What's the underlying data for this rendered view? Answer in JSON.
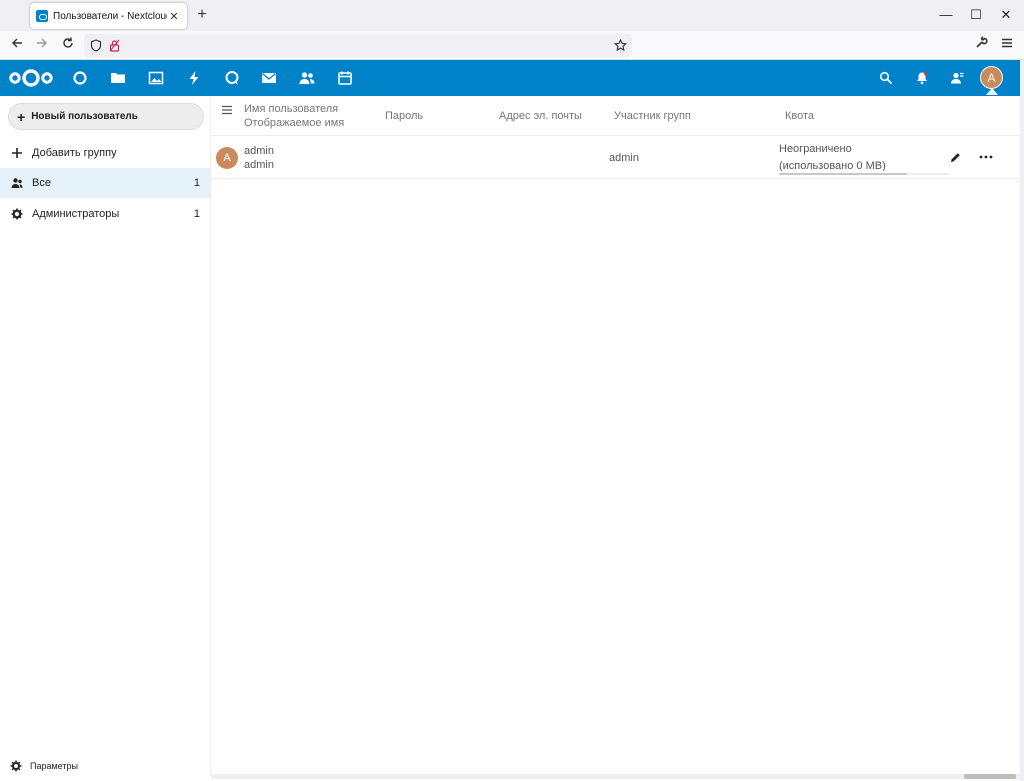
{
  "browser": {
    "tab_title": "Пользователи - Nextcloud",
    "tab_close": "✕",
    "new_tab": "+",
    "controls": {
      "minimize": "—",
      "maximize": "☐",
      "close": "✕"
    },
    "url": ""
  },
  "header": {
    "apps": [
      "dashboard-icon",
      "files-icon",
      "photos-icon",
      "activity-icon",
      "talk-icon",
      "mail-icon",
      "contacts-icon",
      "calendar-icon"
    ],
    "avatar_letter": "A",
    "accent": "#0082c9"
  },
  "sidebar": {
    "new_user": "Новый пользователь",
    "items": [
      {
        "label": "Добавить группу",
        "count": ""
      },
      {
        "label": "Все",
        "count": "1"
      },
      {
        "label": "Администраторы",
        "count": "1"
      }
    ],
    "settings": "Параметры"
  },
  "table": {
    "headers": {
      "username": "Имя пользователя",
      "displayname": "Отображаемое имя",
      "password": "Пароль",
      "email": "Адрес эл. почты",
      "groups": "Участник групп",
      "quota": "Квота"
    },
    "rows": [
      {
        "avatar_letter": "A",
        "username": "admin",
        "displayname": "admin",
        "groups": "admin",
        "quota": "Неограничено (использовано 0 MB)",
        "quota_fraction": 0.75
      }
    ]
  }
}
